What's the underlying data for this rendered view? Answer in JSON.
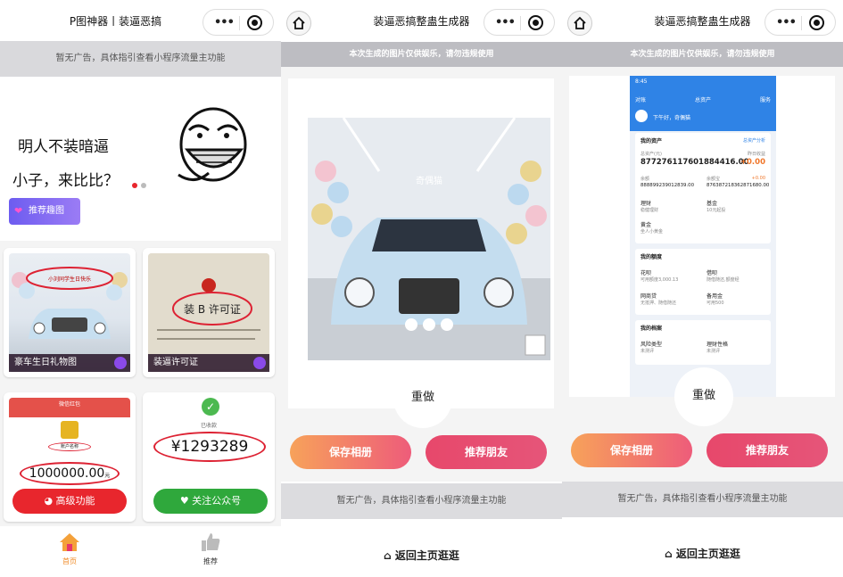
{
  "colors": {
    "accent_red": "#e8262d",
    "accent_green": "#2fa83c",
    "purple": "#7a5cf0",
    "pink": "#e65579",
    "orange": "#f7a25a",
    "blue": "#2f83e6"
  },
  "panel1": {
    "title": "P图神器丨装逼恶搞",
    "ad": "暂无广告，具体指引查看小程序流量主功能",
    "banner": {
      "line1": "明人不装暗逼",
      "line2": "小子，来比比？"
    },
    "recommend_pill": "推荐趣图",
    "cards": [
      {
        "label": "豪车生日礼物图",
        "caption": "小刘同学生日快乐"
      },
      {
        "label": "装逼许可证",
        "caption": "装 B 许可证"
      },
      {
        "header": "微信红包",
        "tag": "账户名称",
        "amount": "1000000.00",
        "unit": "元"
      },
      {
        "header": "已收款",
        "amount": "¥1293289"
      }
    ],
    "buttons": {
      "advanced": "高级功能",
      "follow": "关注公众号"
    },
    "tabs": [
      {
        "label": "首页"
      },
      {
        "label": "推荐"
      }
    ]
  },
  "panel2": {
    "title": "装逼恶搞整蛊生成器",
    "notice": "本次生成的图片仅供娱乐，请勿违规使用",
    "watermark": "奇偶猫",
    "redo": "重做",
    "save": "保存相册",
    "recommend": "推荐朋友",
    "ad": "暂无广告，具体指引查看小程序流量主功能",
    "back_home": "返回主页逛逛"
  },
  "panel3": {
    "title": "装逼恶搞整蛊生成器",
    "notice": "本次生成的图片仅供娱乐，请勿违规使用",
    "redo": "重做",
    "save": "保存相册",
    "recommend": "推荐朋友",
    "ad": "暂无广告，具体指引查看小程序流量主功能",
    "back_home": "返回主页逛逛",
    "phone": {
      "time": "8:45",
      "back": "对账",
      "screen_title": "总资产",
      "help": "服务",
      "user": "下午好，奇偶猫",
      "section_assets": "我的资产",
      "asset_link": "总资产分析",
      "total_label": "总资产(元)",
      "total": "877276117601884416.00",
      "yesterday_label": "昨日收益",
      "yesterday": "+0.00",
      "balance_label": "余额",
      "balance": "888899239012839.00",
      "yuebao_label": "余额宝",
      "yuebao": "876387218362871680.00",
      "yuebao_gain": "+0.00",
      "wealth": "理财",
      "wealth_sub": "稳健理财",
      "fund": "基金",
      "fund_sub": "10元起投",
      "gold": "黄金",
      "gold_sub": "坐人小黄金",
      "section_quota": "我的额度",
      "huabei": "花呗",
      "huabei_sub": "可用额度3,000.13",
      "credit": "借呗",
      "credit_sub": "随借随还,额度经",
      "online": "网商贷",
      "online_sub": "无抵押、随借随还",
      "spare": "备用金",
      "spare_sub": "可用500",
      "section_save": "我的档案",
      "risk": "风险类型",
      "risk_sub": "未测评",
      "pref": "理财性格",
      "pref_sub": "未测评"
    }
  }
}
